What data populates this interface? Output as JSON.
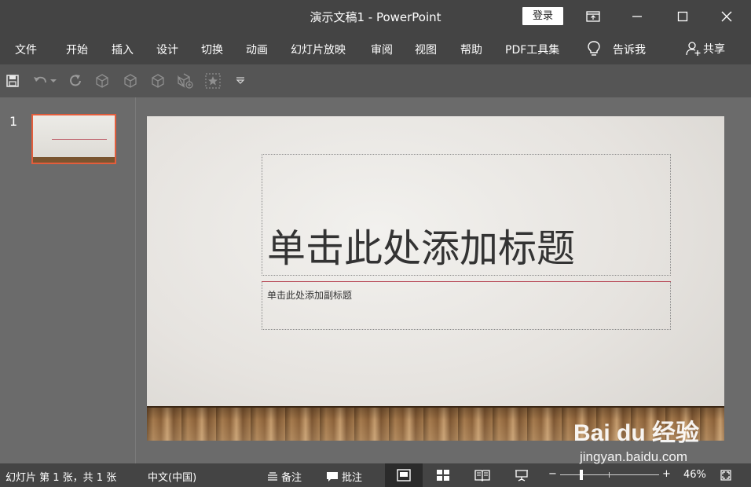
{
  "window": {
    "title": "演示文稿1  -  PowerPoint",
    "login_label": "登录"
  },
  "ribbon": {
    "tabs": [
      "文件",
      "开始",
      "插入",
      "设计",
      "切换",
      "动画",
      "幻灯片放映",
      "审阅",
      "视图",
      "帮助",
      "PDF工具集"
    ],
    "tell_me": "告诉我",
    "share": "共享"
  },
  "qat": {
    "icons": [
      "save-icon",
      "undo-icon",
      "redo-icon",
      "cube-icon",
      "cube-icon",
      "cube-icon",
      "cube-add-icon",
      "star-frame-icon",
      "customize-dropdown-icon"
    ]
  },
  "slides_panel": {
    "slide_number": "1"
  },
  "slide": {
    "title_placeholder": "单击此处添加标题",
    "subtitle_placeholder": "单击此处添加副标题"
  },
  "statusbar": {
    "slide_info": "幻灯片 第 1 张，共 1 张",
    "language": "中文(中国)",
    "notes": "备注",
    "comments": "批注",
    "zoom_minus": "−",
    "zoom_plus": "+",
    "zoom_level": "46%"
  },
  "watermark": {
    "logo": "Bai du 经验",
    "url": "jingyan.baidu.com"
  },
  "colors": {
    "title_bar": "#444444",
    "qat": "#555555",
    "workspace": "#6b6b6b",
    "thumb_selected": "#e35d3c",
    "title_underline": "#b84a58"
  }
}
